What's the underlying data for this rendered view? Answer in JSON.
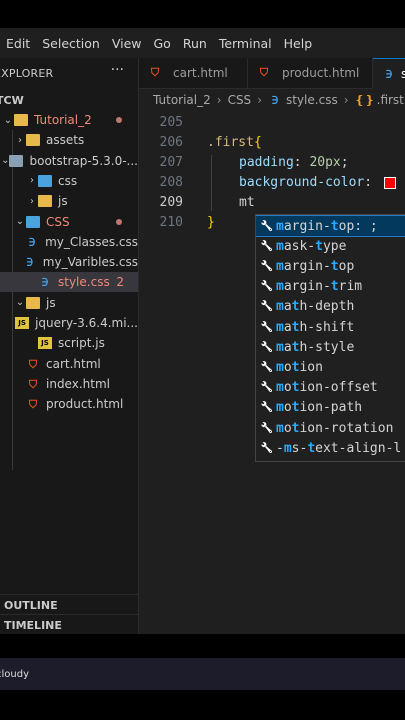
{
  "menu": [
    "Edit",
    "Selection",
    "View",
    "Go",
    "Run",
    "Terminal",
    "Help"
  ],
  "explorer": {
    "title": "EXPLORER",
    "more": "···",
    "root": "TCW",
    "items": [
      {
        "label": "Tutorial_2",
        "type": "folder-open",
        "red": true,
        "dot": true
      },
      {
        "label": "assets",
        "type": "folder"
      },
      {
        "label": "bootstrap-5.3.0-...",
        "type": "folder-open-gray"
      },
      {
        "label": "css",
        "type": "folder-blue"
      },
      {
        "label": "js",
        "type": "folder"
      },
      {
        "label": "CSS",
        "type": "folder-open-blue",
        "red": true,
        "dot": true
      },
      {
        "label": "my_Classes.css",
        "type": "css"
      },
      {
        "label": "my_Varibles.css",
        "type": "css"
      },
      {
        "label": "style.css",
        "type": "css",
        "red": true,
        "badge": "2"
      },
      {
        "label": "js",
        "type": "folder-open"
      },
      {
        "label": "jquery-3.6.4.mi...",
        "type": "js"
      },
      {
        "label": "script.js",
        "type": "js"
      },
      {
        "label": "cart.html",
        "type": "html"
      },
      {
        "label": "index.html",
        "type": "html"
      },
      {
        "label": "product.html",
        "type": "html"
      }
    ],
    "outline": "OUTLINE",
    "timeline": "TIMELINE"
  },
  "tabs": [
    {
      "label": "cart.html",
      "icon": "html"
    },
    {
      "label": "product.html",
      "icon": "html"
    },
    {
      "label": "s",
      "icon": "css",
      "active": true
    }
  ],
  "breadcrumb": [
    "Tutorial_2",
    "CSS",
    "style.css",
    ".first"
  ],
  "editor": {
    "line_numbers": [
      "205",
      "206",
      "207",
      "208",
      "209",
      "210"
    ],
    "current_line": "209",
    "selector": ".first",
    "brace_open": "{",
    "padding_prop": "padding",
    "padding_value": "20px",
    "bg_prop": "background-color",
    "typed": "mt",
    "brace_close": "}",
    "swatch_color": "#ff0000"
  },
  "suggestions": [
    {
      "pre": "",
      "m1": "m",
      "mid": "argin-",
      "m2": "t",
      "post": "op: ;"
    },
    {
      "pre": "",
      "m1": "m",
      "mid": "ask-",
      "m2": "t",
      "post": "ype"
    },
    {
      "pre": "",
      "m1": "m",
      "mid": "argin-",
      "m2": "t",
      "post": "op"
    },
    {
      "pre": "",
      "m1": "m",
      "mid": "argin-",
      "m2": "t",
      "post": "rim"
    },
    {
      "pre": "",
      "m1": "m",
      "mid": "a",
      "m2": "t",
      "post": "h-depth"
    },
    {
      "pre": "",
      "m1": "m",
      "mid": "a",
      "m2": "t",
      "post": "h-shift"
    },
    {
      "pre": "",
      "m1": "m",
      "mid": "a",
      "m2": "t",
      "post": "h-style"
    },
    {
      "pre": "",
      "m1": "m",
      "mid": "o",
      "m2": "t",
      "post": "ion"
    },
    {
      "pre": "",
      "m1": "m",
      "mid": "o",
      "m2": "t",
      "post": "ion-offset"
    },
    {
      "pre": "",
      "m1": "m",
      "mid": "o",
      "m2": "t",
      "post": "ion-path"
    },
    {
      "pre": "",
      "m1": "m",
      "mid": "o",
      "m2": "t",
      "post": "ion-rotation"
    },
    {
      "pre": "-",
      "m1": "m",
      "mid": "s-",
      "m2": "t",
      "post": "ext-align-l"
    }
  ],
  "taskbar": {
    "weather": "cloudy"
  }
}
